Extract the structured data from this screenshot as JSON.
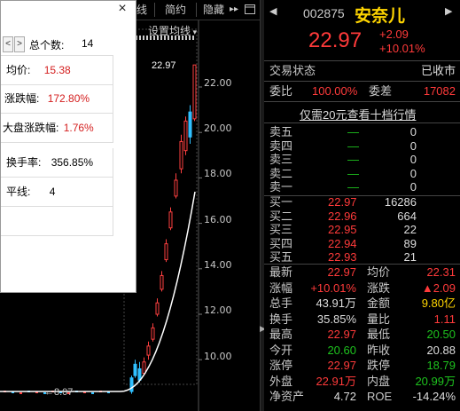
{
  "toolbar": {
    "items": [
      "线",
      "简约",
      "隐藏"
    ],
    "more": "▸▸",
    "setting": "设置均线"
  },
  "chart": {
    "y_ticks": [
      "22.00",
      "20.00",
      "18.00",
      "16.00",
      "14.00",
      "12.00",
      "10.00"
    ],
    "last_price_label": "22.97",
    "bottom_label": "8.07",
    "bottom_label_arrow": "←"
  },
  "popup": {
    "prev": "<",
    "next": ">",
    "close": "×",
    "total_label": "总个数:",
    "total_value": "14",
    "rows": [
      {
        "label": "均价:",
        "value": "15.38"
      },
      {
        "label": "涨跌幅:",
        "value": "172.80%"
      },
      {
        "label": "大盘涨跌幅:",
        "value": "1.76%"
      },
      {
        "label": "换手率:",
        "value": "356.85%"
      },
      {
        "label": "平线:",
        "value": "4"
      }
    ]
  },
  "stock": {
    "code": "002875",
    "name": "安奈儿",
    "price": "22.97",
    "change": "+2.09",
    "change_pct": "+10.01%",
    "status_label": "交易状态",
    "status_value": "已收市",
    "ratio_label": "委比",
    "ratio_value": "100.00%",
    "diff_label": "委差",
    "diff_value": "17082",
    "ten_level_link": "仅需20元查看十档行情"
  },
  "asks": [
    {
      "label": "卖五",
      "price": "—",
      "vol": "0"
    },
    {
      "label": "卖四",
      "price": "—",
      "vol": "0"
    },
    {
      "label": "卖三",
      "price": "—",
      "vol": "0"
    },
    {
      "label": "卖二",
      "price": "—",
      "vol": "0"
    },
    {
      "label": "卖一",
      "price": "—",
      "vol": "0"
    }
  ],
  "bids": [
    {
      "label": "买一",
      "price": "22.97",
      "vol": "16286"
    },
    {
      "label": "买二",
      "price": "22.96",
      "vol": "664"
    },
    {
      "label": "买三",
      "price": "22.95",
      "vol": "22"
    },
    {
      "label": "买四",
      "price": "22.94",
      "vol": "89"
    },
    {
      "label": "买五",
      "price": "22.93",
      "vol": "21"
    }
  ],
  "stats": [
    {
      "l1": "最新",
      "v1": "22.97",
      "c1": "r",
      "l2": "均价",
      "v2": "22.31",
      "c2": "r"
    },
    {
      "l1": "涨幅",
      "v1": "+10.01%",
      "c1": "r",
      "l2": "涨跌",
      "v2": "▲2.09",
      "c2": "r"
    },
    {
      "l1": "总手",
      "v1": "43.91万",
      "c1": "w",
      "l2": "金额",
      "v2": "9.80亿",
      "c2": "y"
    },
    {
      "l1": "换手",
      "v1": "35.85%",
      "c1": "w",
      "l2": "量比",
      "v2": "1.11",
      "c2": "r"
    },
    {
      "l1": "最高",
      "v1": "22.97",
      "c1": "r",
      "l2": "最低",
      "v2": "20.50",
      "c2": "g"
    },
    {
      "l1": "今开",
      "v1": "20.60",
      "c1": "g",
      "l2": "昨收",
      "v2": "20.88",
      "c2": "w"
    },
    {
      "l1": "涨停",
      "v1": "22.97",
      "c1": "r",
      "l2": "跌停",
      "v2": "18.79",
      "c2": "g"
    },
    {
      "l1": "外盘",
      "v1": "22.91万",
      "c1": "r",
      "l2": "内盘",
      "v2": "20.99万",
      "c2": "g"
    },
    {
      "l1": "净资产",
      "v1": "4.72",
      "c1": "w",
      "l2": "ROE",
      "v2": "-14.24%",
      "c2": "w"
    }
  ]
}
